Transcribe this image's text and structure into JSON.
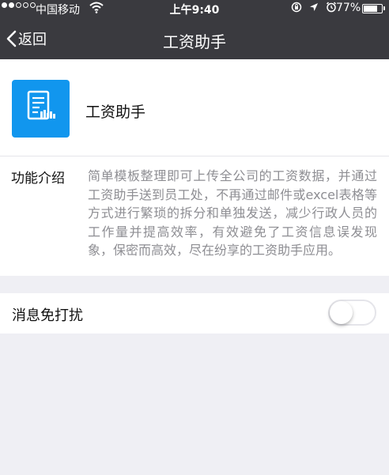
{
  "status_bar": {
    "carrier": "中国移动",
    "time": "上午9:40",
    "battery_percent": "77%",
    "battery_level": 0.77,
    "signal_bars_filled": 2,
    "signal_bars_total": 5,
    "icons": [
      "wifi-icon",
      "orientation-lock-icon",
      "location-icon",
      "alarm-icon",
      "battery-icon"
    ]
  },
  "nav": {
    "back_label": "返回",
    "title": "工资助手"
  },
  "app": {
    "name": "工资助手",
    "icon": "payroll-document-icon",
    "icon_color": "#1196ee"
  },
  "intro": {
    "label": "功能介绍",
    "text": "简单模板整理即可上传全公司的工资数据，并通过工资助手送到员工处，不再通过邮件或excel表格等方式进行繁琐的拆分和单独发送，减少行政人员的工作量并提高效率，有效避免了工资信息误发现象，保密而高效，尽在纷享的工资助手应用。"
  },
  "settings": {
    "do_not_disturb_label": "消息免打扰",
    "do_not_disturb_enabled": false
  },
  "colors": {
    "nav_background": "#3a3a3f",
    "page_background": "#efeff4",
    "secondary_text": "#8e8e93"
  }
}
